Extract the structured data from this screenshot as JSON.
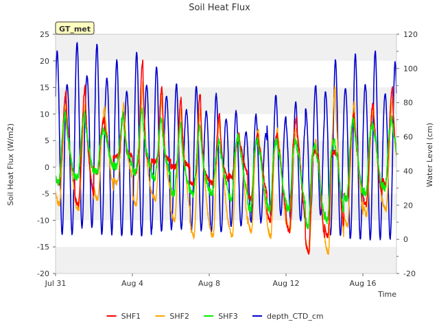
{
  "chart_data": {
    "type": "line",
    "title": "Soil Heat Flux",
    "xlabel": "Time",
    "ylabel": "Soil Heat Flux (W/m2)",
    "y2label": "Water Level (cm)",
    "site_badge": "GT_met",
    "x_ticks": [
      {
        "label": "Jul 31",
        "day": 0
      },
      {
        "label": "Aug 4",
        "day": 4
      },
      {
        "label": "Aug 8",
        "day": 8
      },
      {
        "label": "Aug 12",
        "day": 12
      },
      {
        "label": "Aug 16",
        "day": 16
      }
    ],
    "xlim": [
      "Jul 31",
      "Aug 17 18:00"
    ],
    "ylim": [
      -20,
      25
    ],
    "y_ticks": [
      -20,
      -15,
      -10,
      -5,
      0,
      5,
      10,
      15,
      20,
      25
    ],
    "y2lim": [
      -20,
      120
    ],
    "y2_ticks": [
      -20,
      0,
      20,
      40,
      60,
      80,
      100,
      120
    ],
    "grid": "horizontal bands",
    "legend_position": "bottom",
    "colors": {
      "SHF1": "#ff0000",
      "SHF2": "#ffa500",
      "SHF3": "#00ee00",
      "depth_CTD_cm": "#0000cc"
    },
    "series": [
      {
        "name": "SHF1",
        "axis": "left",
        "daily_max": [
          14,
          15,
          9,
          10,
          20,
          15,
          13,
          14,
          10,
          6,
          6,
          6,
          9,
          3,
          3,
          10,
          12,
          15
        ],
        "daily_min": [
          -3,
          -7,
          -1,
          2,
          -1,
          1,
          0,
          -3,
          -3,
          -2,
          -6,
          -10,
          -12,
          -16,
          -13,
          -6,
          -7,
          -3
        ],
        "base": [
          4,
          3,
          5,
          3,
          3,
          2,
          1,
          0,
          1,
          3,
          2,
          2,
          3,
          2,
          2,
          3,
          4,
          4
        ]
      },
      {
        "name": "SHF2",
        "axis": "left",
        "daily_max": [
          12,
          12,
          11,
          12,
          16,
          14,
          11,
          11,
          9,
          6,
          7,
          7,
          7,
          5,
          15,
          12,
          11,
          13
        ],
        "daily_min": [
          -7,
          -8,
          -6,
          -3,
          -7,
          -6,
          -10,
          -13,
          -13,
          -13,
          -12,
          -13,
          -12,
          -16,
          -16,
          -11,
          -9,
          -8
        ],
        "base": [
          4,
          3,
          5,
          3,
          3,
          2,
          1,
          0,
          0,
          2,
          2,
          2,
          2,
          1,
          2,
          3,
          4,
          3
        ]
      },
      {
        "name": "SHF3",
        "axis": "left",
        "daily_max": [
          10,
          10,
          7,
          10,
          11,
          9,
          8,
          8,
          5,
          6,
          5,
          5,
          5,
          4,
          5,
          9,
          8,
          9
        ],
        "daily_min": [
          -3,
          -2,
          -1,
          0,
          -1,
          -2,
          -5,
          -5,
          -5,
          -6,
          -8,
          -8,
          -8,
          -11,
          -10,
          -6,
          -5,
          -4
        ],
        "base": [
          5,
          5,
          5,
          4,
          4,
          3,
          1,
          1,
          1,
          2,
          2,
          2,
          2,
          1,
          2,
          4,
          5,
          5
        ]
      },
      {
        "name": "depth_CTD_cm",
        "axis": "right",
        "daily_max": [
          110,
          115,
          114,
          105,
          109,
          101,
          91,
          90,
          85,
          75,
          73,
          84,
          80,
          90,
          105,
          108,
          110,
          104
        ],
        "daily_min": [
          3,
          7,
          3,
          2,
          2,
          5,
          6,
          5,
          4,
          8,
          10,
          14,
          11,
          14,
          2,
          0,
          0,
          0
        ],
        "peak_hour": [
          2,
          3,
          4,
          5,
          6,
          7,
          8,
          9,
          10,
          11,
          12,
          13,
          14,
          15,
          16,
          17,
          18,
          19
        ]
      }
    ],
    "legend": [
      "SHF1",
      "SHF2",
      "SHF3",
      "depth_CTD_cm"
    ]
  }
}
